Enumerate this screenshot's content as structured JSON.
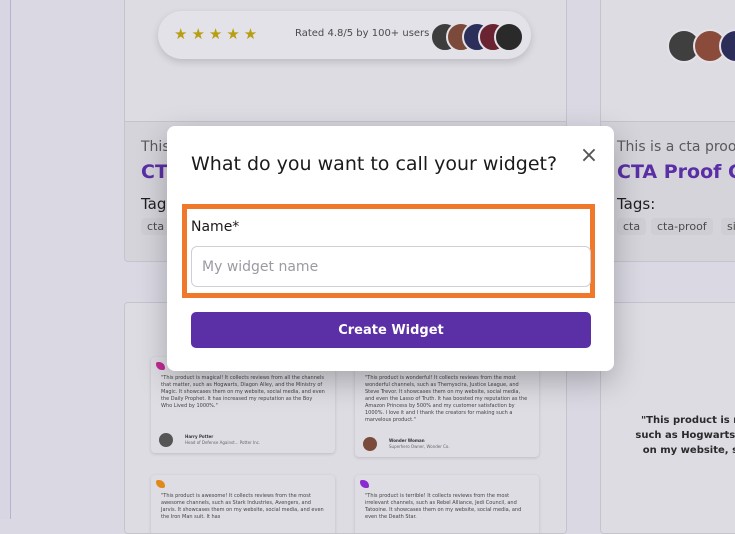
{
  "background_card_top_left": {
    "rating_stars": "★★★★★",
    "rating_text": "Rated 4.8/5 by 100+ users",
    "kicker": "This",
    "title": "CT",
    "tags_label": "Tag",
    "tag_1": "cta"
  },
  "background_card_top_right": {
    "kicker": "This is a cta proof",
    "title": "CTA Proof Co",
    "tags_label": "Tags:",
    "tags": [
      "cta",
      "cta-proof",
      "si"
    ]
  },
  "testimonials": [
    {
      "text": "\"This product is magical! It collects reviews from all the channels that matter, such as Hogwarts, Diagon Alley, and the Ministry of Magic. It showcases them on my website, social media, and even the Daily Prophet. It has increased my reputation as the Boy Who Lived by 1000%.\"",
      "name": "Harry Potter",
      "role": "Head of Defense Against... Potter Inc.",
      "mark_color": "#c02a94"
    },
    {
      "text": "\"This product is wonderful! It collects reviews from the most wonderful channels, such as Themyscira, Justice League, and Steve Trevor. It showcases them on my website, social media, and even the Lasso of Truth. It has boosted my reputation as the Amazon Princess by 500% and my customer satisfaction by 1000%. I love it and I thank the creators for making such a marvelous product.\"",
      "name": "Wonder Woman",
      "role": "Superhero Owner, Wonder Co.",
      "mark_color": "#8a2ad0"
    },
    {
      "text": "\"This product is awesome! It collects reviews from the most awesome channels, such as Stark Industries, Avengers, and Jarvis. It showcases them on my website, social media, and even the Iron Man suit. It has",
      "name": "",
      "role": "",
      "mark_color": "#e08a1c"
    },
    {
      "text": "\"This product is terrible! It collects reviews from the most irrelevant channels, such as Rebel Alliance, Jedi Council, and Tatooine. It showcases them on my website, social media, and even the Death Star.",
      "name": "",
      "role": "",
      "mark_color": "#8a2ad0"
    }
  ],
  "right_quote": "\"This product is magi such as Hogwarts, Dia on my website, socia repu",
  "modal": {
    "title": "What do you want to call your widget?",
    "close_icon": "×",
    "name_label": "Name*",
    "name_placeholder": "My widget name",
    "name_value": "",
    "create_button": "Create Widget",
    "highlight_color": "#f0782b",
    "accent_color": "#5b2fa6"
  }
}
